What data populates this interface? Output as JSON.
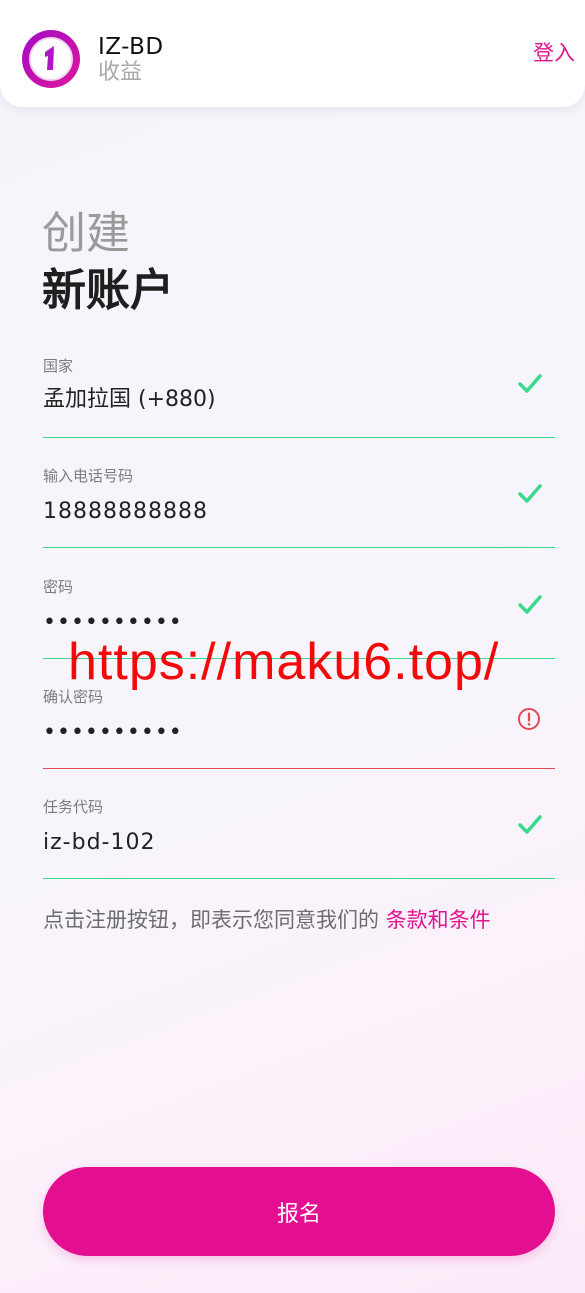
{
  "header": {
    "brand_name": "IZ-BD",
    "brand_sub": "收益",
    "login_label": "登入"
  },
  "title": {
    "light": "创建",
    "bold": "新账户"
  },
  "form": {
    "country": {
      "label": "国家",
      "value": "孟加拉国 (+880)",
      "status": "valid"
    },
    "phone": {
      "label": "输入电话号码",
      "value": "18888888888",
      "status": "valid"
    },
    "password": {
      "label": "密码",
      "value": "••••••••••",
      "status": "valid"
    },
    "confirm_password": {
      "label": "确认密码",
      "value": "••••••••••",
      "status": "error"
    },
    "task_code": {
      "label": "任务代码",
      "value": "iz-bd-102",
      "status": "valid"
    }
  },
  "terms": {
    "text": "点击注册按钮，即表示您同意我们的 ",
    "link": "条款和条件"
  },
  "submit_label": "报名",
  "watermark": "https://maku6.top/",
  "colors": {
    "accent": "#e40e90",
    "valid": "#3ad98d",
    "error": "#e24a55"
  }
}
